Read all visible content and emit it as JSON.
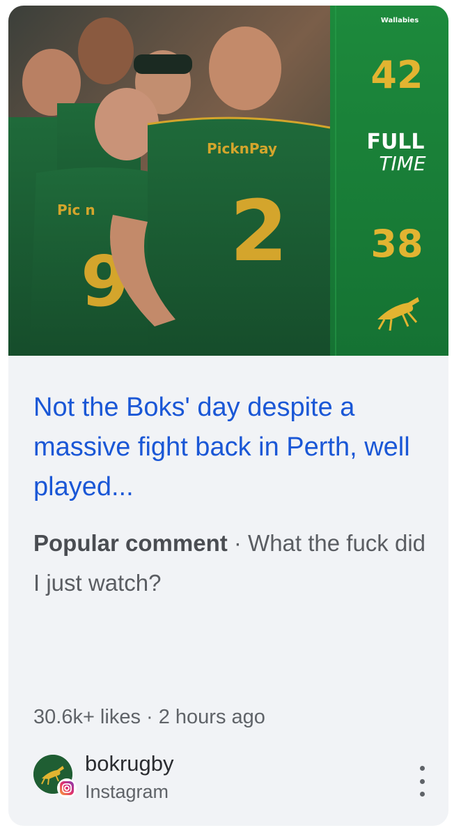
{
  "post": {
    "image_alt": "Springboks players in green jerseys with full time score",
    "scoreboard": {
      "sponsor": "Wallabies",
      "home_score": "42",
      "status_line1": "FULL",
      "status_line2": "TIME",
      "away_score": "38"
    },
    "jersey_sponsor": "PicknPay",
    "jersey_numbers": [
      "2",
      "9"
    ],
    "headline": "Not the Boks' day despite a massive fight back in Perth, well played...",
    "comment_label": "Popular comment",
    "comment_separator": " · ",
    "comment_text": "What the fuck did I just watch?",
    "likes": "30.6k+ likes",
    "meta_separator": " · ",
    "time_ago": "2 hours ago"
  },
  "source": {
    "account": "bokrugby",
    "platform": "Instagram",
    "avatar_icon": "springbok-icon",
    "badge_icon": "instagram-icon",
    "more_icon": "more-vertical-icon"
  },
  "colors": {
    "card_bg": "#f1f3f6",
    "headline": "#1a57d6",
    "score_gold": "#e2b431",
    "panel_green": "#1f8a3c"
  }
}
